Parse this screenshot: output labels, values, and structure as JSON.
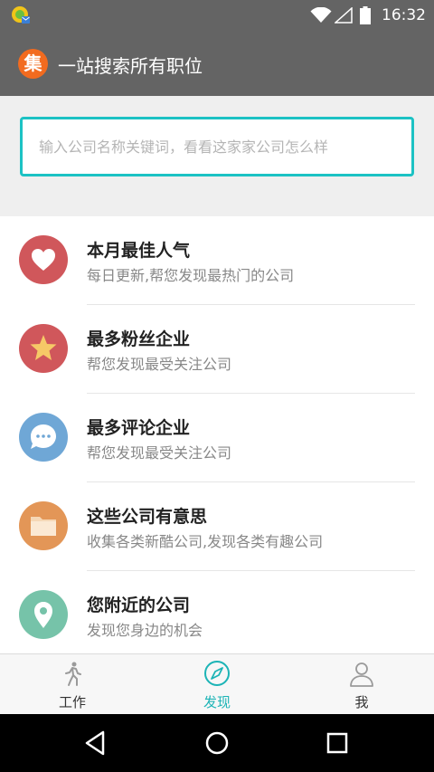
{
  "status_bar": {
    "time": "16:32",
    "icons": [
      "notification-icon",
      "wifi-icon",
      "signal-icon",
      "battery-icon"
    ]
  },
  "app_bar": {
    "logo_char": "集",
    "title": "一站搜索所有职位",
    "logo_color": "#f26b1f"
  },
  "search": {
    "placeholder": "输入公司名称关键词，看看这家家公司怎么样",
    "value": "",
    "border_color": "#1cc2c4"
  },
  "list": {
    "items": [
      {
        "title": "本月最佳人气",
        "subtitle": "每日更新,帮您发现最热门的公司",
        "icon": "heart-icon",
        "color": "#d0575b"
      },
      {
        "title": "最多粉丝企业",
        "subtitle": "帮您发现最受关注公司",
        "icon": "star-icon",
        "color": "#d0575b"
      },
      {
        "title": "最多评论企业",
        "subtitle": "帮您发现最受关注公司",
        "icon": "chat-bubble-icon",
        "color": "#6fa7d6"
      },
      {
        "title": "这些公司有意思",
        "subtitle": "收集各类新酷公司,发现各类有趣公司",
        "icon": "folder-icon",
        "color": "#e39657"
      },
      {
        "title": "您附近的公司",
        "subtitle": "发现您身边的机会",
        "icon": "location-pin-icon",
        "color": "#76c3a9"
      }
    ]
  },
  "tabs": [
    {
      "label": "工作",
      "icon": "walking-person-icon",
      "active": false
    },
    {
      "label": "发现",
      "icon": "compass-icon",
      "active": true
    },
    {
      "label": "我",
      "icon": "user-icon",
      "active": false
    }
  ],
  "accent_color": "#1cb4b6",
  "nav_bar": {
    "buttons": [
      "back-icon",
      "home-icon",
      "recents-icon"
    ]
  }
}
